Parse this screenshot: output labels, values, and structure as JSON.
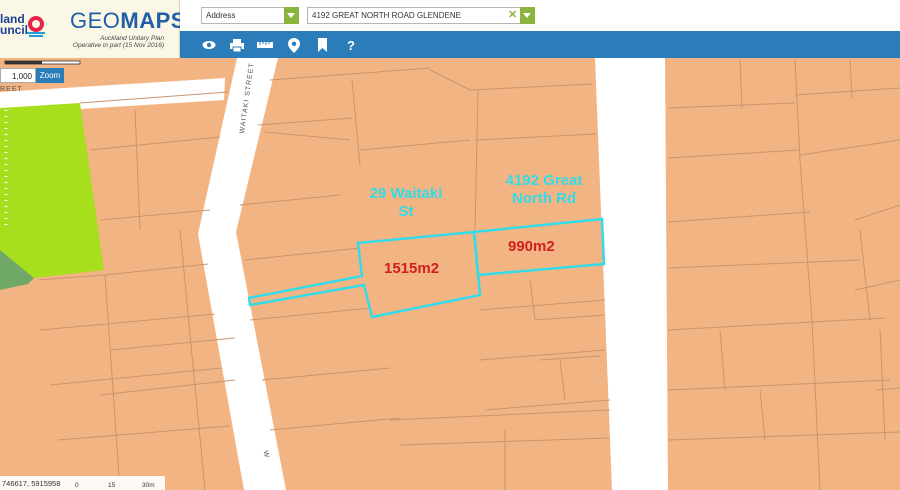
{
  "header": {
    "council_line1": "land",
    "council_line2": "uncil",
    "app_name_part1": "GEO",
    "app_name_part2": "MAPS",
    "plan_line1": "Auckland Unitary Plan",
    "plan_line2": "Operative in part (15 Nov 2016)"
  },
  "search": {
    "type_value": "Address",
    "address_value": "4192 GREAT NORTH ROAD GLENDENE",
    "clear_symbol": "✕"
  },
  "toolbar": {
    "tools": [
      "eye-icon",
      "print-icon",
      "measure-icon",
      "map-pin-icon",
      "bookmark-icon",
      "help-icon"
    ],
    "help_symbol": "?"
  },
  "map": {
    "scale_value": "1,000",
    "zoom_label": "Zoom",
    "streets": {
      "waitaki_vertical": "WAITAKI STREET",
      "left_partial": "REET",
      "bottom_partial": "W"
    },
    "labels": {
      "lot1_line1": "29 Waitaki",
      "lot1_line2": "St",
      "lot2_line1": "4192 Great",
      "lot2_line2": "North Rd",
      "lot1_area": "1515m2",
      "lot2_area": "990m2"
    },
    "coords": "746617, 5915958",
    "scalebar_ticks": [
      "0",
      "15",
      "30m"
    ],
    "colors": {
      "parcel": "#f3b483",
      "road": "#ffffff",
      "park": "#a7df1c",
      "highlight": "#33dbe8",
      "area_text": "#cf1f1f",
      "toolbar": "#2a7db8",
      "accent_green": "#8ab43e"
    }
  }
}
